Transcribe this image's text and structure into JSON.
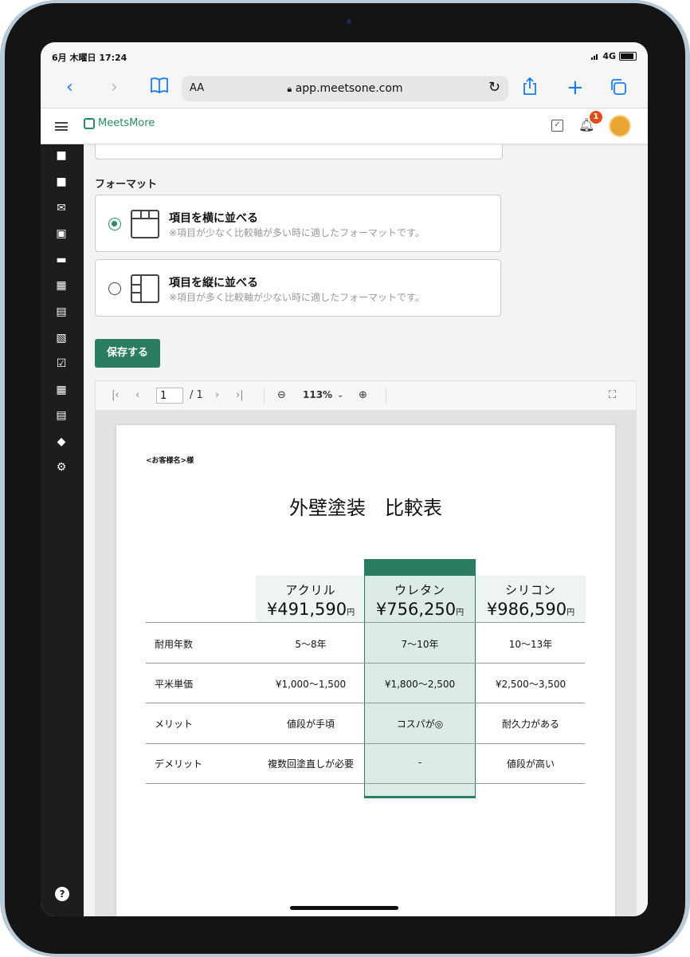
{
  "status": {
    "time": "6月 木曜日 17:24",
    "network": "4G"
  },
  "browser": {
    "text_size_label": "AA",
    "url": "app.meetsone.com",
    "icons": [
      "back-icon",
      "forward-icon",
      "bookmarks-icon",
      "reload-icon",
      "share-icon",
      "new-tab-icon",
      "tabs-icon"
    ]
  },
  "app": {
    "logo_text": "MeetsMore",
    "notification_count": "1"
  },
  "sidebar": {
    "icons": [
      "briefcase-add-icon",
      "briefcase-icon",
      "mail-icon",
      "calendar-icon",
      "truck-icon",
      "cashier-icon",
      "boxes-icon",
      "checklist-icon",
      "checkbox-icon",
      "calculator-icon",
      "document-icon",
      "package-icon",
      "gear-icon"
    ],
    "help": "?"
  },
  "form": {
    "format_label": "フォーマット",
    "options": [
      {
        "title": "項目を横に並べる",
        "desc": "※項目が少なく比較軸が多い時に適したフォーマットです。",
        "selected": true
      },
      {
        "title": "項目を縦に並べる",
        "desc": "※項目が多く比較軸が少ない時に適したフォーマットです。",
        "selected": false
      }
    ],
    "save_label": "保存する"
  },
  "pdf": {
    "page": "1",
    "total": "/ 1",
    "zoom": "113%",
    "customer": "<お客様名>様",
    "title": "外壁塗装　比較表",
    "yen_unit": "円",
    "accent": "#2a7d60",
    "columns": [
      {
        "name": "アクリル",
        "price": "¥491,590"
      },
      {
        "name": "ウレタン",
        "price": "¥756,250"
      },
      {
        "name": "シリコン",
        "price": "¥986,590"
      }
    ],
    "rows": [
      {
        "label": "耐用年数",
        "values": [
          "5～8年",
          "7～10年",
          "10～13年"
        ]
      },
      {
        "label": "平米単価",
        "values": [
          "¥1,000～1,500",
          "¥1,800～2,500",
          "¥2,500～3,500"
        ]
      },
      {
        "label": "メリット",
        "values": [
          "値段が手頃",
          "コスパが◎",
          "耐久力がある"
        ]
      },
      {
        "label": "デメリット",
        "values": [
          "複数回塗直しが必要",
          "-",
          "値段が高い"
        ]
      }
    ]
  }
}
